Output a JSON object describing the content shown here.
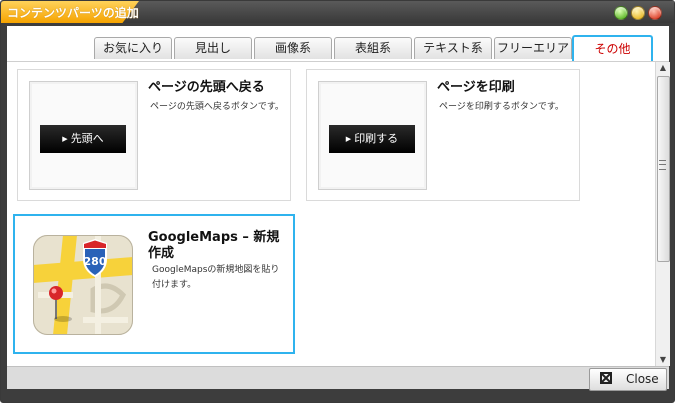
{
  "window": {
    "title": "コンテンツパーツの追加"
  },
  "tabs": [
    {
      "label": "お気に入り",
      "active": false
    },
    {
      "label": "見出し",
      "active": false
    },
    {
      "label": "画像系",
      "active": false
    },
    {
      "label": "表組系",
      "active": false
    },
    {
      "label": "テキスト系",
      "active": false
    },
    {
      "label": "フリーエリア",
      "active": false
    },
    {
      "label": "その他",
      "active": true
    }
  ],
  "cards": [
    {
      "title": "ページの先頭へ戻る",
      "description": "ページの先頭へ戻るボタンです。",
      "button_label": "先頭へ",
      "icon": "black-button-thumbnail"
    },
    {
      "title": "ページを印刷",
      "description": "ページを印刷するボタンです。",
      "button_label": "印刷する",
      "icon": "black-button-thumbnail"
    },
    {
      "title": "GoogleMaps – 新規作成",
      "description": "GoogleMapsの新規地図を貼り付けます。",
      "icon": "google-maps-icon",
      "map_icon_text": "280",
      "selected": true
    }
  ],
  "footer": {
    "close_label": "Close"
  },
  "colors": {
    "accent": "#2fb3ee",
    "active_tab_text": "#cc0000",
    "title_tab": "#f5a300"
  }
}
